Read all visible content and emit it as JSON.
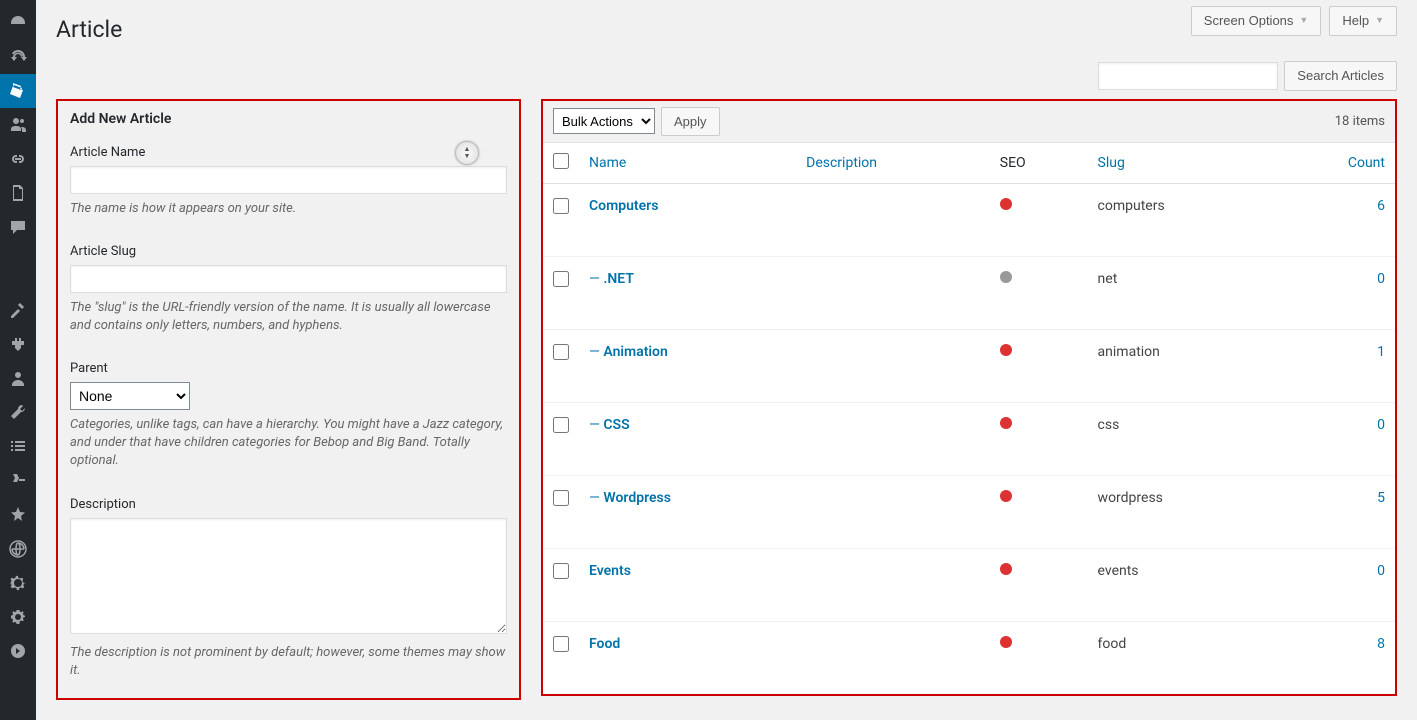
{
  "header": {
    "screen_options": "Screen Options",
    "help": "Help",
    "page_title": "Article",
    "search_button": "Search Articles"
  },
  "form": {
    "title": "Add New Article",
    "name_label": "Article Name",
    "name_help": "The name is how it appears on your site.",
    "slug_label": "Article Slug",
    "slug_help": "The \"slug\" is the URL-friendly version of the name. It is usually all lowercase and contains only letters, numbers, and hyphens.",
    "parent_label": "Parent",
    "parent_selected": "None",
    "parent_help": "Categories, unlike tags, can have a hierarchy. You might have a Jazz category, and under that have children categories for Bebop and Big Band. Totally optional.",
    "desc_label": "Description",
    "desc_help": "The description is not prominent by default; however, some themes may show it."
  },
  "table": {
    "bulk_label": "Bulk Actions",
    "apply_label": "Apply",
    "items_count": "18 items",
    "columns": {
      "name": "Name",
      "description": "Description",
      "seo": "SEO",
      "slug": "Slug",
      "count": "Count"
    },
    "rows": [
      {
        "name": "Computers",
        "prefix": "",
        "seo": "red",
        "slug": "computers",
        "count": "6"
      },
      {
        "name": ".NET",
        "prefix": "— ",
        "seo": "gray",
        "slug": "net",
        "count": "0"
      },
      {
        "name": "Animation",
        "prefix": "— ",
        "seo": "red",
        "slug": "animation",
        "count": "1"
      },
      {
        "name": "CSS",
        "prefix": "— ",
        "seo": "red",
        "slug": "css",
        "count": "0"
      },
      {
        "name": "Wordpress",
        "prefix": "— ",
        "seo": "red",
        "slug": "wordpress",
        "count": "5"
      },
      {
        "name": "Events",
        "prefix": "",
        "seo": "red",
        "slug": "events",
        "count": "0"
      },
      {
        "name": "Food",
        "prefix": "",
        "seo": "red",
        "slug": "food",
        "count": "8"
      }
    ]
  }
}
